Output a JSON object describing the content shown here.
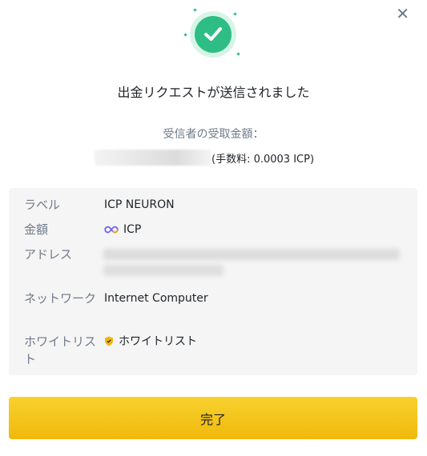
{
  "dialog": {
    "close_label": "✕",
    "title": "出金リクエストが送信されました",
    "received_label": "受信者の受取金額：",
    "fee_text": "(手数料: 0.0003 ICP)"
  },
  "details": {
    "label": {
      "key": "ラベル",
      "value": "ICP NEURON"
    },
    "amount": {
      "key": "金額",
      "value": "ICP",
      "icon": "infinity-icon"
    },
    "address": {
      "key": "アドレス"
    },
    "network": {
      "key": "ネットワーク",
      "value": "Internet Computer"
    },
    "whitelist": {
      "key": "ホワイトリスト",
      "value": "ホワイトリスト",
      "icon": "shield-icon"
    }
  },
  "actions": {
    "done_label": "完了"
  },
  "colors": {
    "accent": "#f0b90b",
    "success": "#2ebd85",
    "muted": "#707a8a"
  }
}
